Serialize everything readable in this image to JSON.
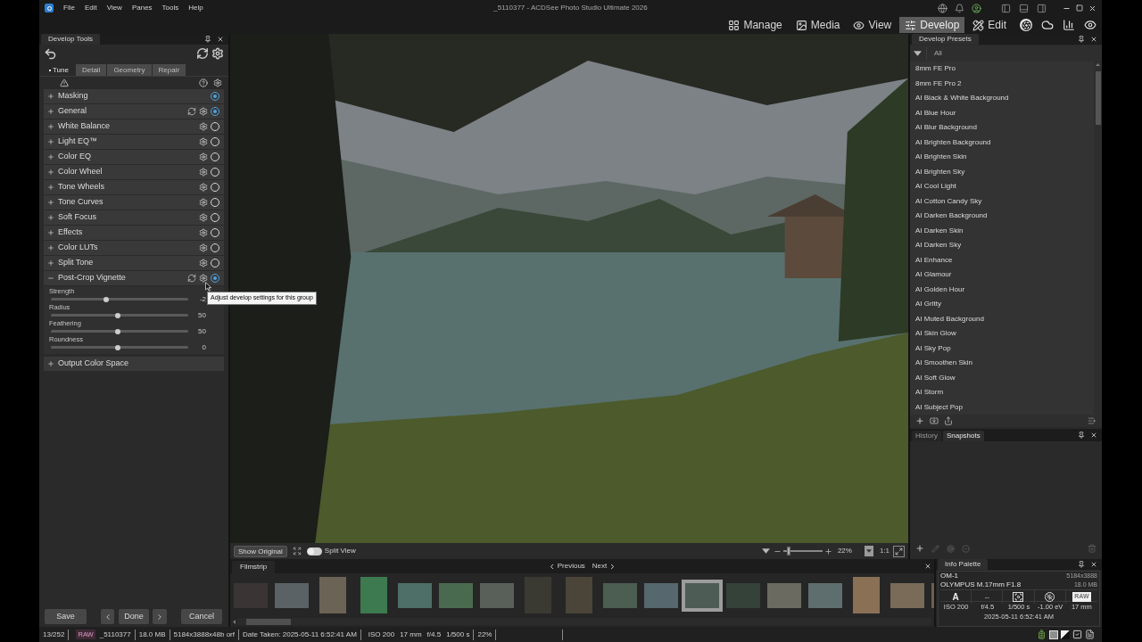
{
  "title_bar": {
    "menus": [
      "File",
      "Edit",
      "View",
      "Panes",
      "Tools",
      "Help"
    ],
    "title": "_5110377 - ACDSee Photo Studio Ultimate 2026"
  },
  "modes": [
    {
      "label": "Manage",
      "selected": false
    },
    {
      "label": "Media",
      "selected": false
    },
    {
      "label": "View",
      "selected": false
    },
    {
      "label": "Develop",
      "selected": true
    },
    {
      "label": "Edit",
      "selected": false
    }
  ],
  "develop_tools": {
    "title": "Develop Tools",
    "tabs": [
      {
        "label": "Tune",
        "selected": true
      },
      {
        "label": "Detail",
        "selected": false
      },
      {
        "label": "Geometry",
        "selected": false
      },
      {
        "label": "Repair",
        "selected": false
      }
    ],
    "groups": [
      {
        "label": "Masking",
        "expanded": false,
        "reset": false,
        "settings": false,
        "on": true
      },
      {
        "label": "General",
        "expanded": false,
        "reset": true,
        "settings": true,
        "on": true
      },
      {
        "label": "White Balance",
        "expanded": false,
        "reset": false,
        "settings": true,
        "on": false
      },
      {
        "label": "Light EQ™",
        "expanded": false,
        "reset": false,
        "settings": true,
        "on": false
      },
      {
        "label": "Color EQ",
        "expanded": false,
        "reset": false,
        "settings": true,
        "on": false
      },
      {
        "label": "Color Wheel",
        "expanded": false,
        "reset": false,
        "settings": true,
        "on": false
      },
      {
        "label": "Tone Wheels",
        "expanded": false,
        "reset": false,
        "settings": true,
        "on": false
      },
      {
        "label": "Tone Curves",
        "expanded": false,
        "reset": false,
        "settings": true,
        "on": false
      },
      {
        "label": "Soft Focus",
        "expanded": false,
        "reset": false,
        "settings": true,
        "on": false
      },
      {
        "label": "Effects",
        "expanded": false,
        "reset": false,
        "settings": true,
        "on": false
      },
      {
        "label": "Color LUTs",
        "expanded": false,
        "reset": false,
        "settings": true,
        "on": false
      },
      {
        "label": "Split Tone",
        "expanded": false,
        "reset": false,
        "settings": true,
        "on": false
      },
      {
        "label": "Post-Crop Vignette",
        "expanded": true,
        "reset": true,
        "settings": true,
        "on": true,
        "sliders": [
          {
            "label": "Strength",
            "level": 0.4,
            "reading": "-2"
          },
          {
            "label": "Radius",
            "level": 0.49,
            "reading": "50"
          },
          {
            "label": "Feathering",
            "level": 0.49,
            "reading": "50"
          },
          {
            "label": "Roundness",
            "level": 0.49,
            "reading": "0"
          }
        ]
      },
      {
        "label": "Output Color Space",
        "expanded": false
      }
    ],
    "tooltip": "Adjust develop settings for this group",
    "actions": {
      "save": "Save",
      "done": "Done",
      "cancel": "Cancel"
    }
  },
  "image_view": {
    "toolbar": {
      "show_original": "Show Original",
      "split_view": {
        "label": "Split View",
        "on": false
      },
      "zoom": {
        "level": 0.15,
        "value": "22%"
      },
      "ratio": "1:1"
    }
  },
  "filmstrip": {
    "title": "Filmstrip",
    "previous": "Previous",
    "next": "Next",
    "thumbnails": [
      {
        "kind": "landscape",
        "selected": false
      },
      {
        "kind": "landscape",
        "selected": false
      },
      {
        "kind": "portrait",
        "selected": false
      },
      {
        "kind": "portrait",
        "selected": false
      },
      {
        "kind": "landscape",
        "selected": false
      },
      {
        "kind": "landscape",
        "selected": false
      },
      {
        "kind": "landscape",
        "selected": false
      },
      {
        "kind": "portrait",
        "selected": false
      },
      {
        "kind": "portrait",
        "selected": false
      },
      {
        "kind": "landscape",
        "selected": false
      },
      {
        "kind": "landscape",
        "selected": false
      },
      {
        "kind": "landscape",
        "selected": true
      },
      {
        "kind": "landscape",
        "selected": false
      },
      {
        "kind": "landscape",
        "selected": false
      },
      {
        "kind": "landscape",
        "selected": false
      },
      {
        "kind": "portrait",
        "selected": false
      },
      {
        "kind": "landscape",
        "selected": false
      },
      {
        "kind": "landscape",
        "selected": false
      }
    ]
  },
  "presets": {
    "title": "Develop Presets",
    "filter": "All",
    "items": [
      "8mm FE Pro",
      "8mm FE Pro 2",
      "AI Black & White Background",
      "AI Blue Hour",
      "AI Blur Background",
      "AI Brighten Background",
      "AI Brighten Skin",
      "AI Brighten Sky",
      "AI Cool Light",
      "AI Cotton Candy Sky",
      "AI Darken Background",
      "AI Darken Skin",
      "AI Darken Sky",
      "AI Enhance",
      "AI Glamour",
      "AI Golden Hour",
      "AI Gritty",
      "AI Muted Background",
      "AI Skin Glow",
      "AI Sky Pop",
      "AI Smoothen Skin",
      "AI Soft Glow",
      "AI Storm",
      "AI Subject Pop"
    ]
  },
  "snapshots": {
    "tabs": [
      {
        "label": "History",
        "selected": false
      },
      {
        "label": "Snapshots",
        "selected": true
      }
    ]
  },
  "info_palette": {
    "title": "Info Palette",
    "camera": "OM-1",
    "lens": "OLYMPUS M.17mm F1.8",
    "dimensions": "5184x3888",
    "size": "18.0 MB",
    "mode": "A",
    "column_2": "--",
    "format": "RAW",
    "exposure": [
      "ISO 200",
      "f/4.5",
      "1/500 s",
      "-1.00 eV",
      "17 mm"
    ],
    "date": "2025-05-11 6:52:41 AM"
  },
  "status_bar": {
    "position": "13/252",
    "format": "RAW",
    "filename": "_5110377",
    "size": "18.0 MB",
    "dimensions": "5184x3888x48b orf",
    "date": "Date Taken: 2025-05-11 6:52:41 AM",
    "exposure": [
      "ISO 200",
      "17 mm",
      "f/4.5",
      "1/500 s"
    ],
    "zoom": "22%"
  }
}
